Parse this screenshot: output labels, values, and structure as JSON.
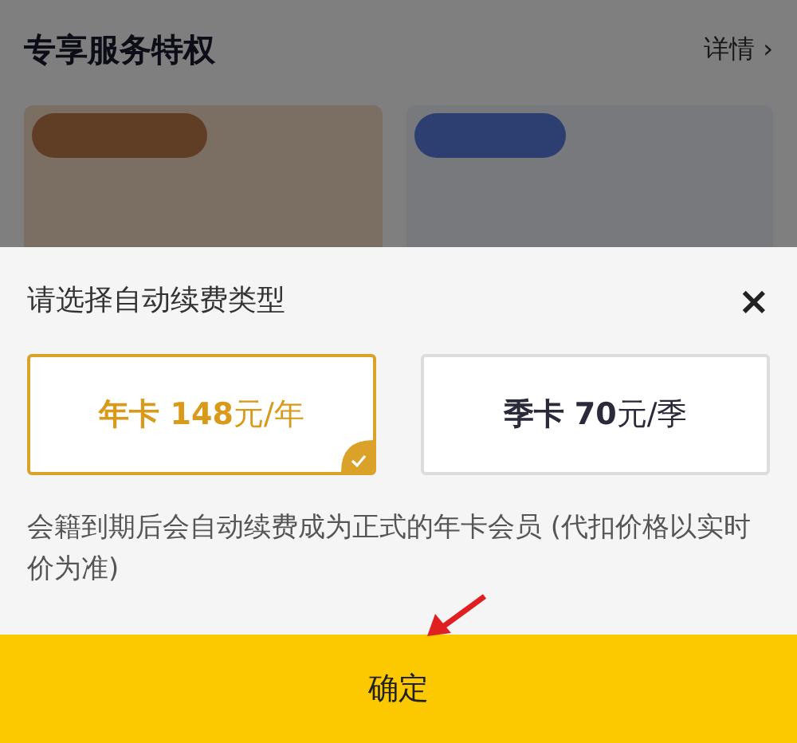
{
  "background": {
    "section_title": "专享服务特权",
    "details_link": "详情 ›"
  },
  "sheet": {
    "title": "请选择自动续费类型",
    "close": "×",
    "options": [
      {
        "label": "**年卡 148**元/年",
        "selected": true
      },
      {
        "label": "**季卡 70**元/季",
        "selected": false
      }
    ],
    "note": "会籍到期后会自动续费成为正式的年卡会员 (代扣价格以实时价为准)",
    "confirm": "确定"
  }
}
